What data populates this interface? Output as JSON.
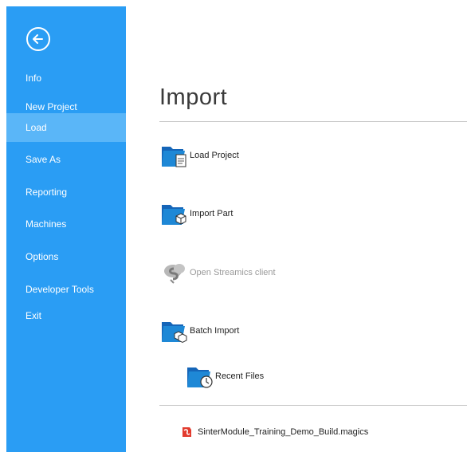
{
  "sidebar": {
    "back_icon": "back-arrow-circle-icon",
    "items": [
      {
        "label": "Info"
      },
      {
        "label": "New Project"
      },
      {
        "label": "Load"
      },
      {
        "label": "Save As"
      },
      {
        "label": "Reporting"
      },
      {
        "label": "Machines"
      },
      {
        "label": "Options"
      },
      {
        "label": "Developer Tools"
      },
      {
        "label": "Exit"
      }
    ],
    "active_item": "Load"
  },
  "main": {
    "title": "Import",
    "actions": [
      {
        "label": "Load Project",
        "icon": "folder-document-icon",
        "enabled": true
      },
      {
        "label": "Import Part",
        "icon": "folder-cube-icon",
        "enabled": true
      },
      {
        "label": "Open Streamics client",
        "icon": "streamics-cloud-icon",
        "enabled": false
      },
      {
        "label": "Batch Import",
        "icon": "folder-cubes-icon",
        "enabled": true
      },
      {
        "label": "Recent Files",
        "icon": "folder-clock-icon",
        "enabled": true
      }
    ],
    "recent_files": [
      {
        "name": "SinterModule_Training_Demo_Build.magics",
        "icon": "magics-file-icon"
      }
    ]
  },
  "colors": {
    "sidebar": "#2a9df4",
    "sidebar_active": "#5ab6f8",
    "folder": "#1e88d6",
    "disabled_text": "#9a9a9a"
  }
}
